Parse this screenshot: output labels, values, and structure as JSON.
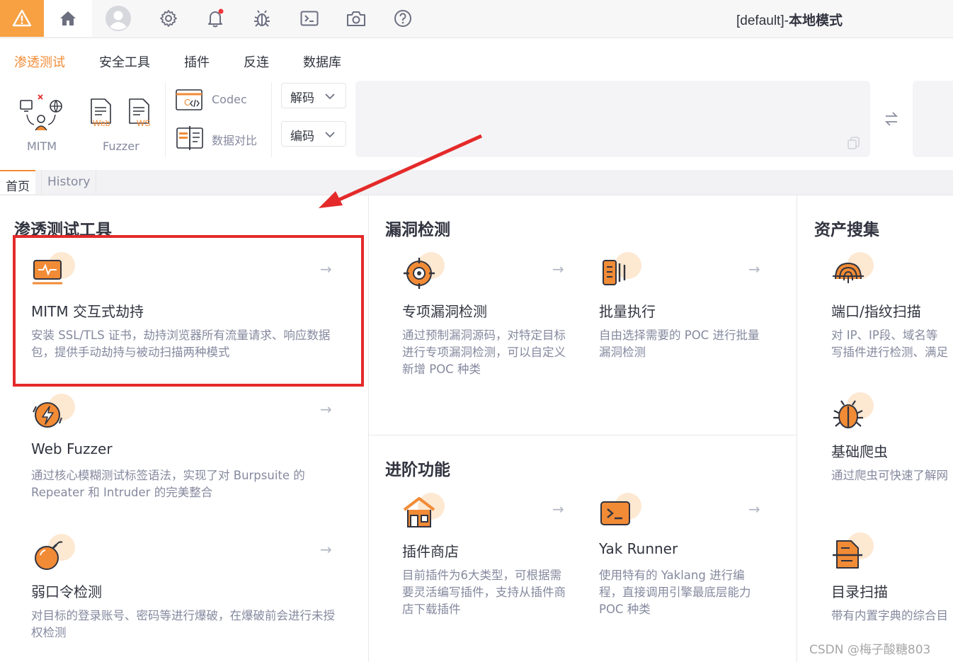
{
  "header": {
    "mode_prefix": "[default]-",
    "mode_bold": "本地模式"
  },
  "menu": {
    "items": [
      "渗透测试",
      "安全工具",
      "插件",
      "反连",
      "数据库"
    ]
  },
  "toolbar": {
    "mitm_label": "MITM",
    "fuzzer_label": "Fuzzer",
    "web_label": "Web",
    "ws_label": "WS",
    "codec_label": "Codec",
    "diff_label": "数据对比",
    "decode_select": "解码",
    "encode_select": "编码"
  },
  "tabs": [
    "首页",
    "History"
  ],
  "sections": {
    "pentest": {
      "title": "渗透测试工具",
      "cards": [
        {
          "title": "MITM 交互式劫持",
          "desc": "安装 SSL/TLS 证书，劫持浏览器所有流量请求、响应数据包，提供手动劫持与被动扫描两种模式",
          "icon": "monitor-pulse-icon"
        },
        {
          "title": "Web Fuzzer",
          "desc": "通过核心模糊测试标签语法，实现了对 Burpsuite 的 Repeater 和 Intruder 的完美整合",
          "icon": "fuzzer-bolt-icon"
        },
        {
          "title": "弱口令检测",
          "desc": "对目标的登录账号、密码等进行爆破，在爆破前会进行未授权检测",
          "icon": "bomb-icon"
        }
      ]
    },
    "vuln": {
      "title": "漏洞检测",
      "cards": [
        {
          "title": "专项漏洞检测",
          "desc": "通过预制漏洞源码，对特定目标进行专项漏洞检测，可以自定义新增 POC 种类",
          "icon": "crosshair-icon"
        },
        {
          "title": "批量执行",
          "desc": "自由选择需要的 POC 进行批量漏洞检测",
          "icon": "batch-docs-icon"
        }
      ]
    },
    "advanced": {
      "title": "进阶功能",
      "cards": [
        {
          "title": "插件商店",
          "desc": "目前插件为6大类型，可根据需要灵活编写插件，支持从插件商店下载插件",
          "icon": "store-house-icon"
        },
        {
          "title": "Yak Runner",
          "desc": "使用特有的 Yaklang 进行编程，直接调用引擎最底层能力 POC 种类",
          "icon": "terminal-icon"
        }
      ]
    },
    "asset": {
      "title": "资产搜集",
      "cards": [
        {
          "title": "端口/指纹扫描",
          "desc": "对 IP、IP段、域名等",
          "desc2": "写插件进行检测、满足",
          "icon": "fingerprint-icon"
        },
        {
          "title": "基础爬虫",
          "desc": "通过爬虫可快速了解网",
          "icon": "bug-icon"
        },
        {
          "title": "目录扫描",
          "desc": "带有内置字典的综合目",
          "icon": "file-scan-icon"
        }
      ]
    }
  },
  "watermark": "CSDN @梅子酸糖803",
  "colors": {
    "accent": "#f28b36",
    "warning_bg": "#f7a143",
    "highlight": "#e42a2a"
  }
}
